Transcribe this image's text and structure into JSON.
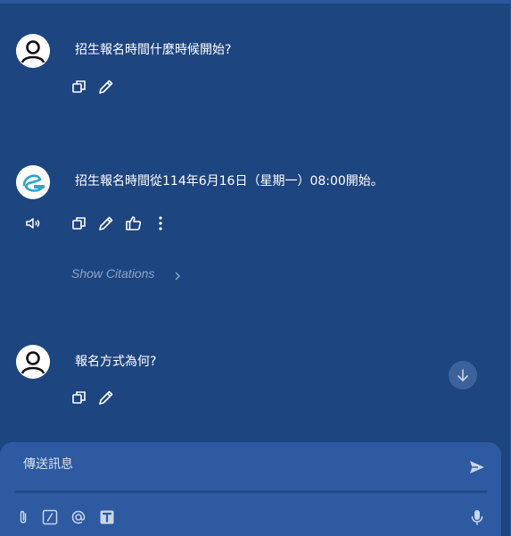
{
  "conversation": {
    "messages": [
      {
        "role": "user",
        "text": "招生報名時間什麼時候開始?"
      },
      {
        "role": "assistant",
        "text": "招生報名時間從114年6月16日（星期一）08:00開始。",
        "citations_label": "Show Citations"
      },
      {
        "role": "user",
        "text": "報名方式為何?"
      }
    ]
  },
  "composer": {
    "placeholder": "傳送訊息"
  },
  "icons": {
    "copy": "copy-icon",
    "edit": "pencil-icon",
    "speaker": "speaker-icon",
    "like": "thumbs-up-icon",
    "more": "more-vertical-icon",
    "send": "send-icon",
    "attach": "paperclip-icon",
    "slash": "slash-command-icon",
    "mention": "at-icon",
    "template": "text-template-icon",
    "mic": "microphone-icon",
    "scroll": "arrow-down-icon"
  },
  "colors": {
    "background": "#1d4580",
    "composer": "#2d5aa0",
    "muted_text": "#8ea6c8",
    "text": "#ffffff"
  }
}
